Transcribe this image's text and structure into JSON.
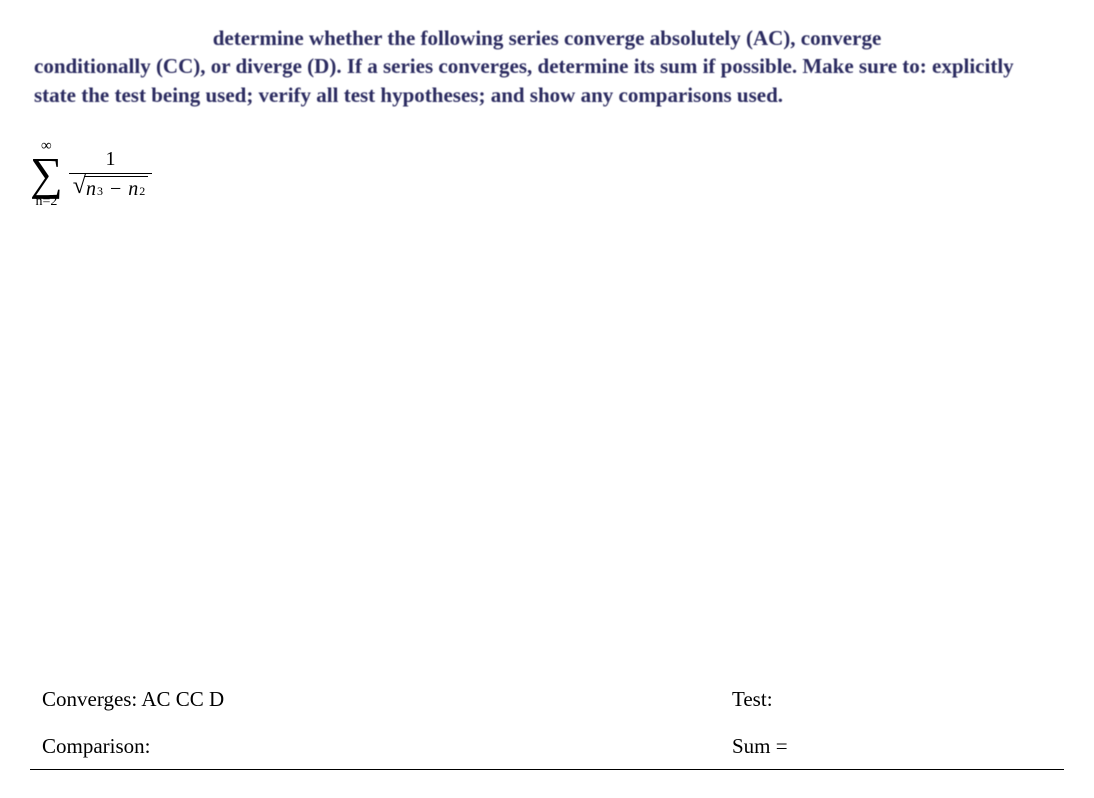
{
  "instructions": {
    "line1": "determine whether the following series converge absolutely (AC), converge",
    "line2": "conditionally (CC), or diverge (D). If a series converges, determine its sum if possible. Make sure",
    "line3": "to: explicitly state the test being used; verify all test hypotheses; and show any comparisons used."
  },
  "series": {
    "sigma_top": "∞",
    "sigma_bottom": "n=2",
    "numerator": "1",
    "radicand_term1_base": "n",
    "radicand_term1_exp": "3",
    "radicand_minus": "−",
    "radicand_term2_base": "n",
    "radicand_term2_exp": "2"
  },
  "answers": {
    "converges_label": "Converges:  AC CC D",
    "test_label": "Test:",
    "comparison_label": "Comparison:",
    "sum_label": "Sum ="
  }
}
